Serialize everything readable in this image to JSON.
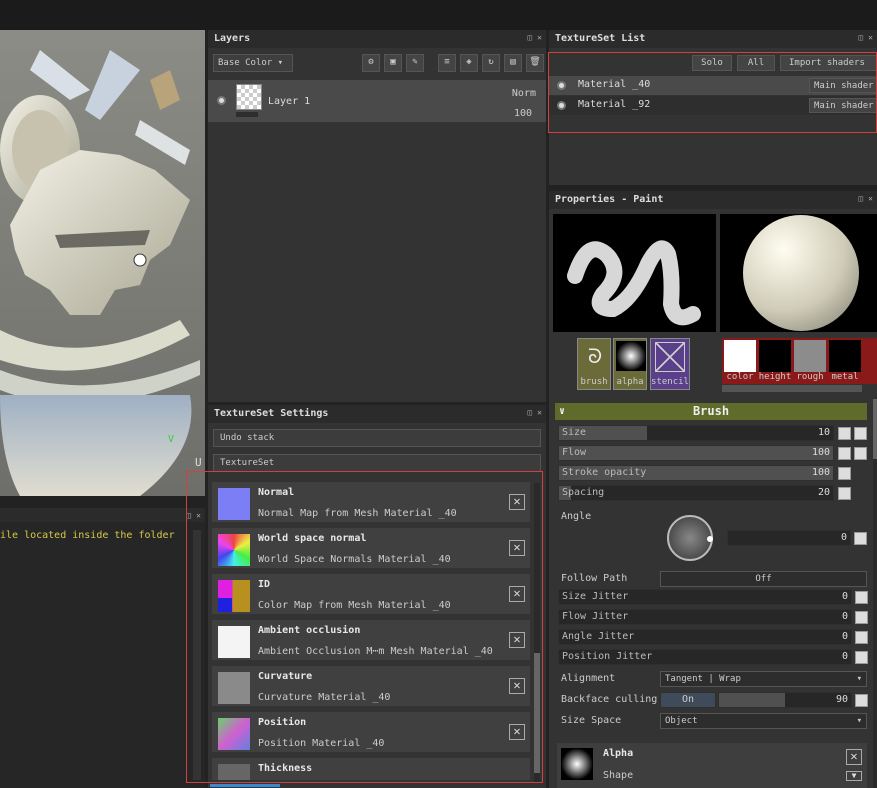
{
  "viewport": {
    "axis_y": "V",
    "axis_x": "U"
  },
  "log": {
    "text": "ile located inside the folder"
  },
  "layers": {
    "title": "Layers",
    "channel": "Base Color ▾",
    "layer": {
      "name": "Layer 1",
      "blend": "Norm",
      "opacity": "100"
    }
  },
  "textureset_list": {
    "title": "TextureSet List",
    "solo": "Solo",
    "all": "All",
    "import": "Import shaders",
    "materials": [
      {
        "name": "Material _40",
        "shader": "Main shader"
      },
      {
        "name": "Material _92",
        "shader": "Main shader"
      }
    ]
  },
  "textureset_settings": {
    "title": "TextureSet Settings",
    "undo_stack": "Undo stack",
    "textureset": "TextureSet",
    "maps": [
      {
        "name": "Normal",
        "desc": "Normal Map from Mesh Material _40"
      },
      {
        "name": "World space normal",
        "desc": "World Space Normals Material _40"
      },
      {
        "name": "ID",
        "desc": "Color Map from Mesh Material _40"
      },
      {
        "name": "Ambient occlusion",
        "desc": "Ambient Occlusion M⋯m Mesh Material _40"
      },
      {
        "name": "Curvature",
        "desc": "Curvature Material _40"
      },
      {
        "name": "Position",
        "desc": "Position Material _40"
      },
      {
        "name": "Thickness",
        "desc": ""
      }
    ]
  },
  "properties": {
    "title": "Properties - Paint",
    "slots": {
      "brush": "brush",
      "alpha": "alpha",
      "stencil": "stencil",
      "color": "color",
      "height": "height",
      "rough": "rough",
      "metal": "metal"
    },
    "brush_header": "Brush",
    "sliders": [
      {
        "label": "Size",
        "value": "10",
        "level": 0.3
      },
      {
        "label": "Flow",
        "value": "100",
        "level": 1.0
      },
      {
        "label": "Stroke opacity",
        "value": "100",
        "level": 1.0
      },
      {
        "label": "Spacing",
        "value": "20",
        "level": 0.04
      }
    ],
    "angle_label": "Angle",
    "angle_value": "0",
    "follow_path_label": "Follow Path",
    "follow_path_value": "Off",
    "jitters": [
      {
        "label": "Size Jitter",
        "value": "0"
      },
      {
        "label": "Flow Jitter",
        "value": "0"
      },
      {
        "label": "Angle Jitter",
        "value": "0"
      },
      {
        "label": "Position Jitter",
        "value": "0"
      }
    ],
    "alignment_label": "Alignment",
    "alignment_value": "Tangent | Wrap",
    "backface_label": "Backface culling",
    "backface_toggle": "On",
    "backface_value": "90",
    "size_space_label": "Size Space",
    "size_space_value": "Object",
    "alpha_title": "Alpha",
    "alpha_sub": "Shape"
  }
}
